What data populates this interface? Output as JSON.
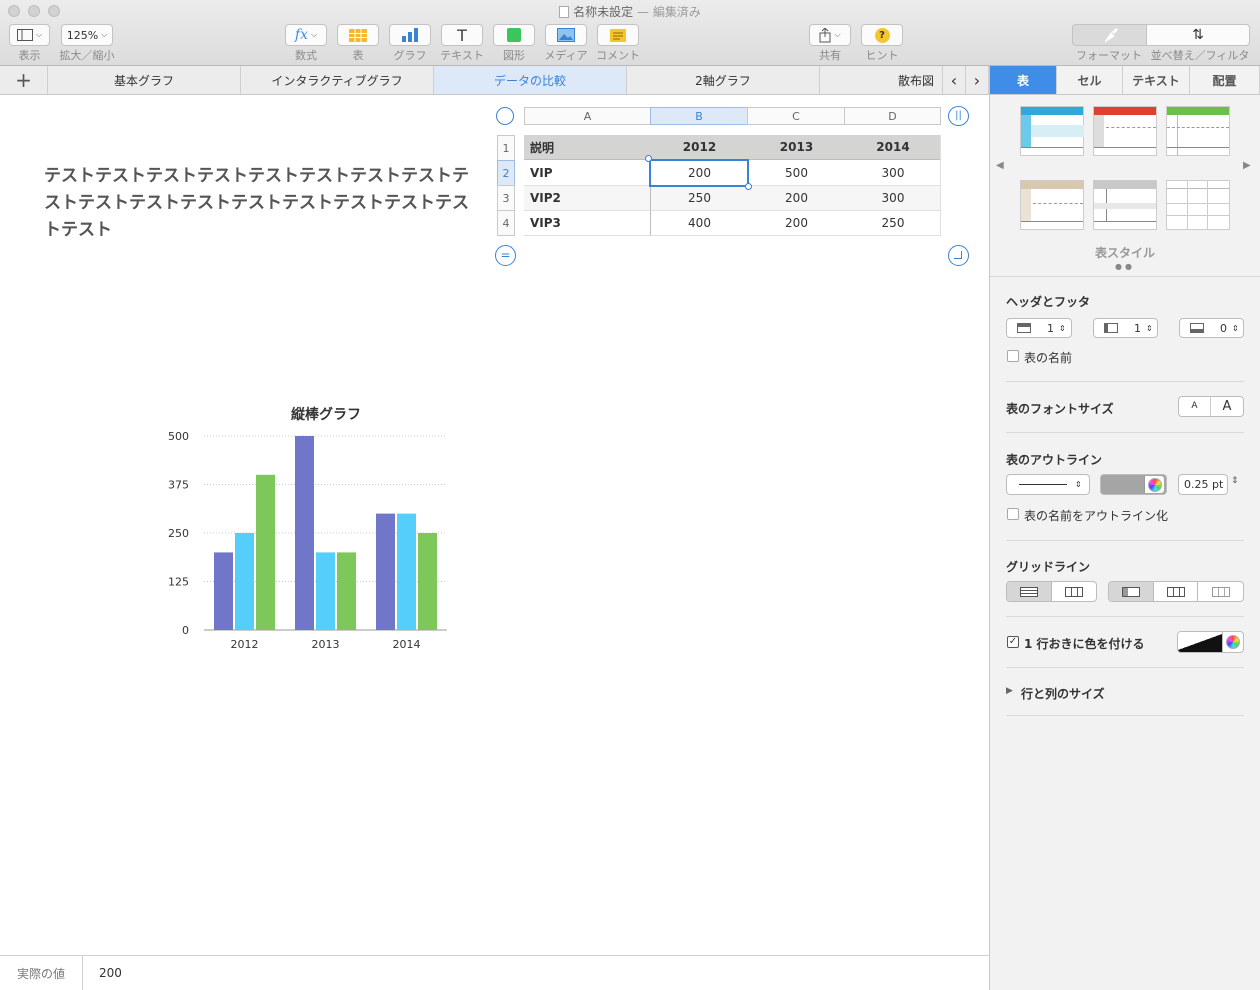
{
  "window": {
    "title": "名称未設定",
    "status": "— 編集済み"
  },
  "toolbar": {
    "view_label": "表示",
    "zoom_value": "125%",
    "zoom_label": "拡大／縮小",
    "formula_label": "数式",
    "table_label": "表",
    "chart_label": "グラフ",
    "text_label": "テキスト",
    "shape_label": "図形",
    "media_label": "メディア",
    "comment_label": "コメント",
    "share_label": "共有",
    "tips_label": "ヒント",
    "format_label": "フォーマット",
    "sort_label": "並べ替え／フィルタ"
  },
  "sheets": {
    "add_label": "+",
    "tabs": [
      "基本グラフ",
      "インタラクティブグラフ",
      "データの比較",
      "2軸グラフ",
      "散布図"
    ],
    "active": "データの比較"
  },
  "canvas": {
    "text_box": "テストテストテストテストテストテストテストテストテストテストテストテストテストテストテストテストテストテスト"
  },
  "table": {
    "col_letters": [
      "A",
      "B",
      "C",
      "D"
    ],
    "row_numbers": [
      "1",
      "2",
      "3",
      "4"
    ],
    "header": [
      "説明",
      "2012",
      "2013",
      "2014"
    ],
    "rows": [
      [
        "VIP",
        "200",
        "500",
        "300"
      ],
      [
        "VIP2",
        "250",
        "200",
        "300"
      ],
      [
        "VIP3",
        "400",
        "200",
        "250"
      ]
    ]
  },
  "chart_data": {
    "type": "bar",
    "title": "縦棒グラフ",
    "categories": [
      "2012",
      "2013",
      "2014"
    ],
    "series": [
      {
        "values": [
          200,
          500,
          300
        ],
        "color": "#7177c8"
      },
      {
        "values": [
          250,
          200,
          300
        ],
        "color": "#56cefb"
      },
      {
        "values": [
          400,
          200,
          250
        ],
        "color": "#7ec75b"
      }
    ],
    "ylim": [
      0,
      500
    ],
    "yticks": [
      0,
      125,
      250,
      375,
      500
    ],
    "grid": true,
    "legend": "none"
  },
  "sidebar": {
    "tabs": [
      "表",
      "セル",
      "テキスト",
      "配置"
    ],
    "active_tab": "表",
    "styles_label": "表スタイル",
    "headers_title": "ヘッダとフッタ",
    "header_rows": "1",
    "header_cols": "1",
    "footer_rows": "0",
    "table_name_label": "表の名前",
    "font_size_title": "表のフォントサイズ",
    "font_small": "A",
    "font_large": "A",
    "outline_title": "表のアウトライン",
    "outline_width": "0.25 pt",
    "outline_name_label": "表の名前をアウトライン化",
    "gridlines_title": "グリッドライン",
    "alternate_label": "1 行おきに色を付ける",
    "alternate_checked": "✓",
    "row_col_size_label": "行と列のサイズ"
  },
  "footer": {
    "label": "実際の値",
    "value": "200"
  }
}
